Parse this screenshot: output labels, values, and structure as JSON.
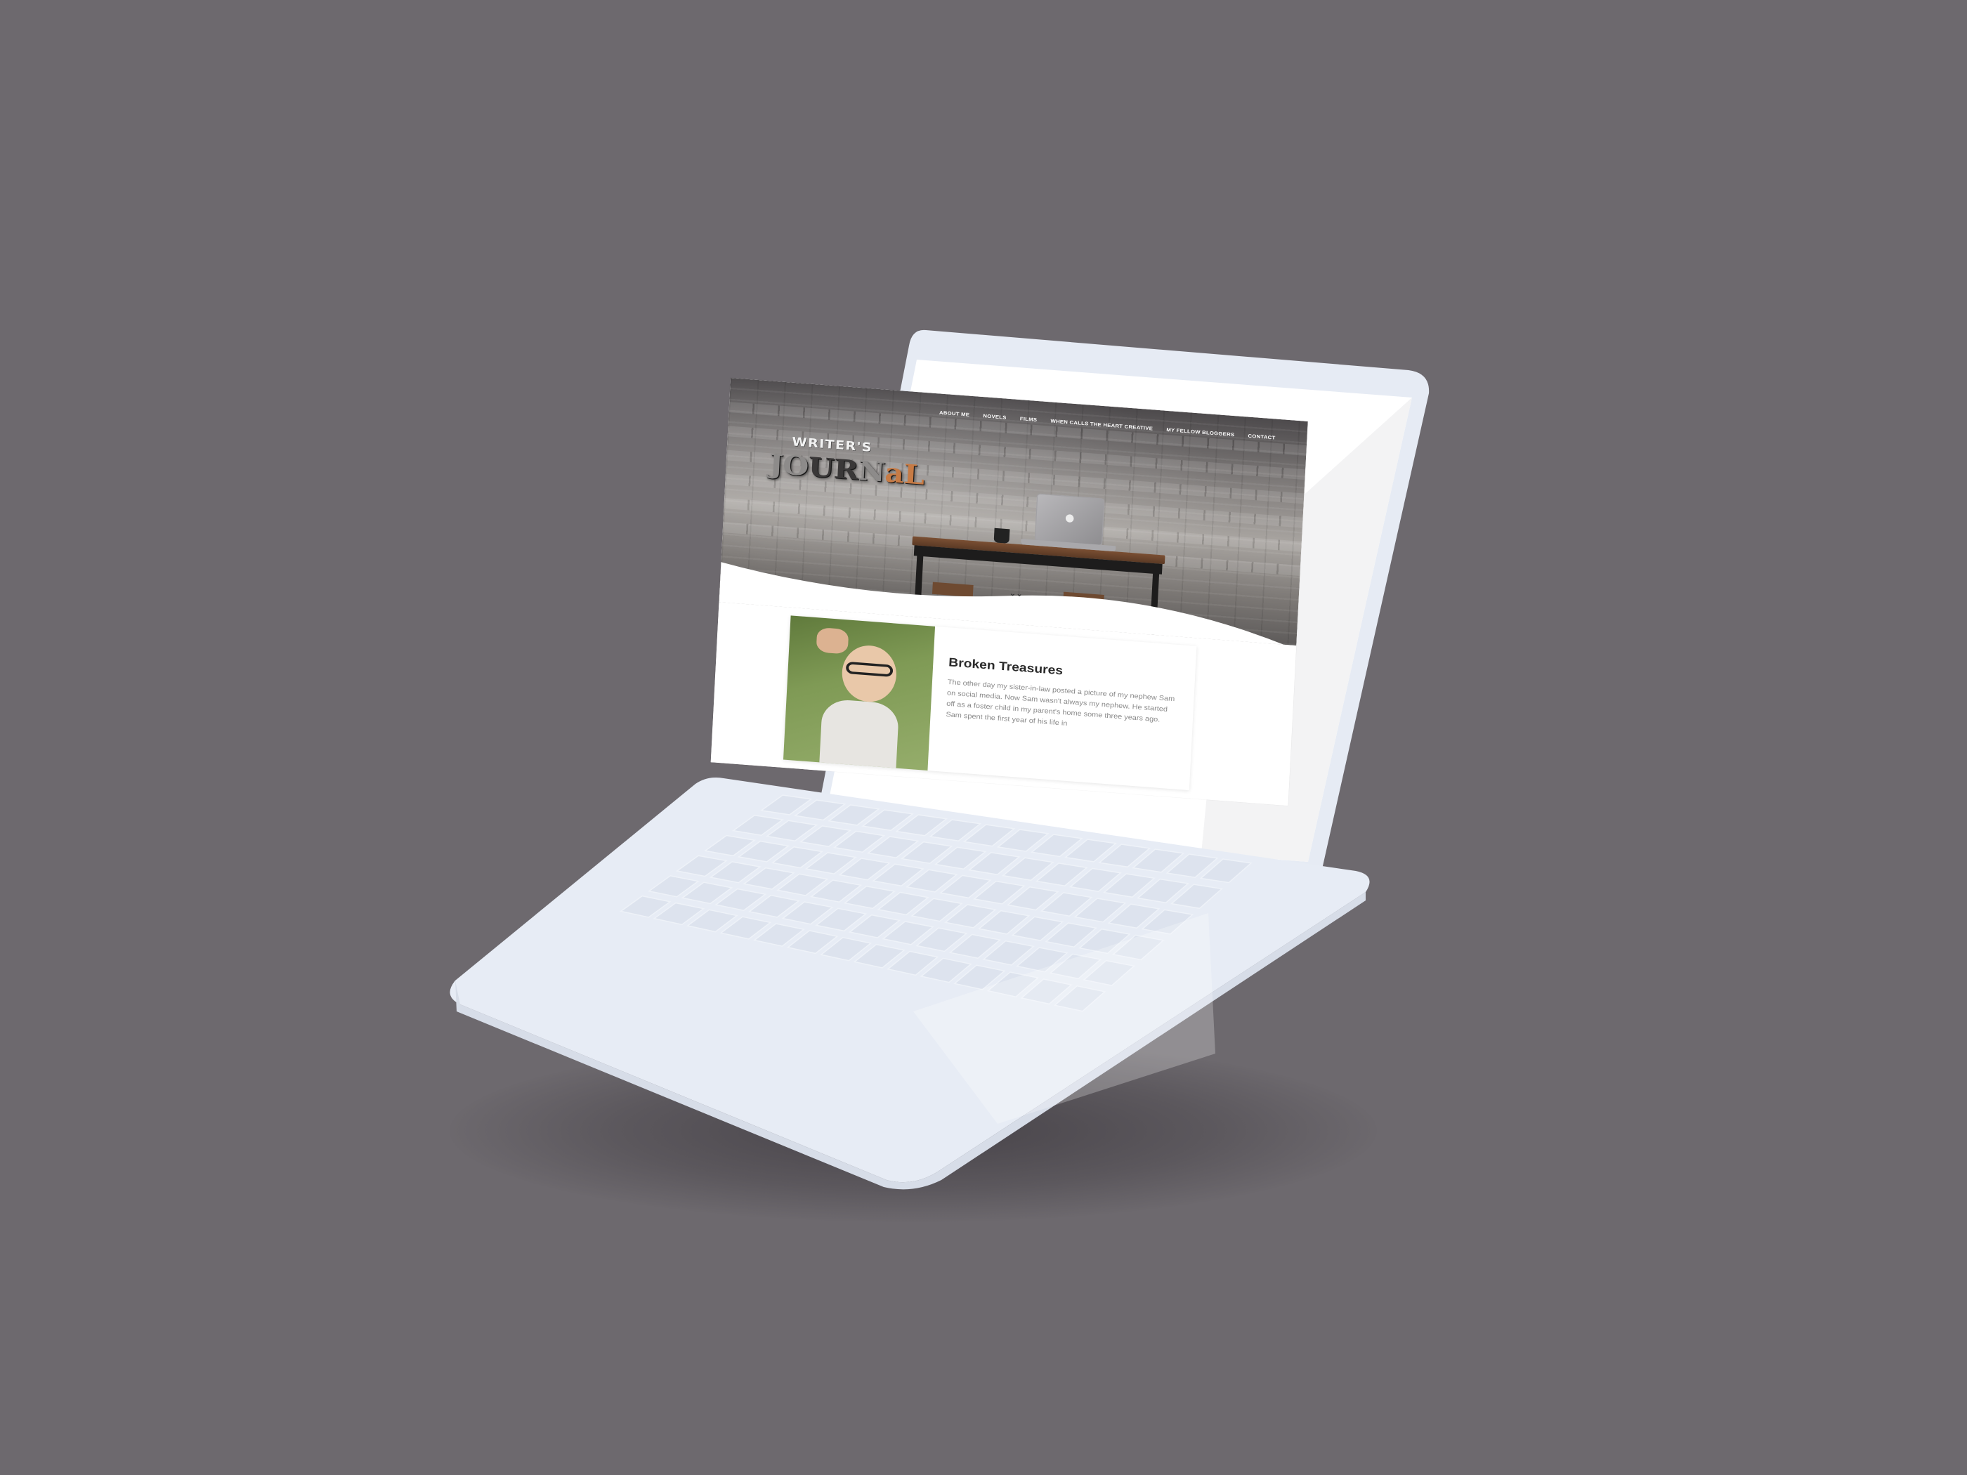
{
  "nav": {
    "items": [
      {
        "label": "ABOUT ME"
      },
      {
        "label": "NOVELS"
      },
      {
        "label": "FILMS"
      },
      {
        "label": "WHEN CALLS THE HEART CREATIVE"
      },
      {
        "label": "MY FELLOW BLOGGERS"
      },
      {
        "label": "CONTACT"
      }
    ]
  },
  "logo": {
    "top": "WRITER'S",
    "main_j": "J",
    "main_o": "O",
    "main_ur": "UR",
    "main_n": "N",
    "main_al": "aL"
  },
  "hero": {
    "scroll_cue": "⌄⌄"
  },
  "post": {
    "title": "Broken Treasures",
    "excerpt": "The other day my sister-in-law posted a picture of my nephew Sam on social media. Now Sam wasn't always my nephew. He started off as a foster child in my parent's home some three years ago. Sam spent the first year of his life in"
  },
  "colors": {
    "background": "#6d696e",
    "laptop_body": "#e6ebf4",
    "accent_copper": "#c77b45"
  }
}
